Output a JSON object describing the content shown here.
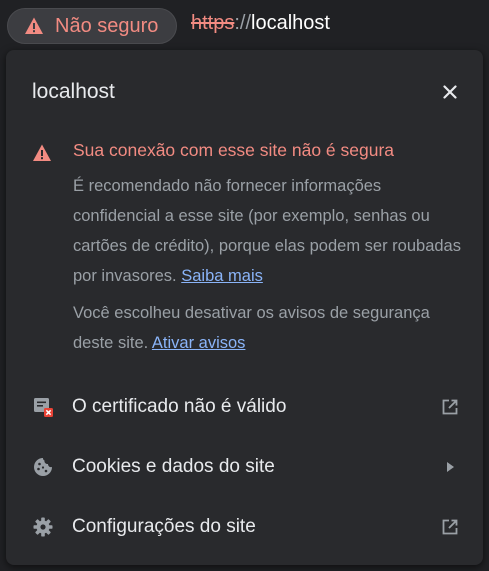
{
  "address_bar": {
    "security_chip_label": "Não seguro",
    "url_scheme": "https",
    "url_separator": "://",
    "url_host": "localhost"
  },
  "popup": {
    "title": "localhost",
    "close_icon": "close-icon",
    "warning": {
      "heading": "Sua conexão com esse site não é segura",
      "body": "É recomendado não fornecer informações confidencial a esse site (por exemplo, senhas ou cartões de crédito), porque elas podem ser roubadas por invasores.",
      "learn_more": "Saiba mais",
      "disabled_text": "Você escolheu desativar os avisos de segurança deste site.",
      "enable_link": "Ativar avisos"
    },
    "rows": [
      {
        "label": "O certificado não é válido",
        "icon": "certificate-error-icon",
        "end_icon": "external-link-icon"
      },
      {
        "label": "Cookies e dados do site",
        "icon": "cookie-icon",
        "end_icon": "chevron-right-icon"
      },
      {
        "label": "Configurações do site",
        "icon": "gear-icon",
        "end_icon": "external-link-icon"
      }
    ]
  },
  "colors": {
    "warning_red": "#f28b82",
    "link_blue": "#8ab4f8",
    "panel_bg": "#292a2d",
    "page_bg": "#202124"
  }
}
